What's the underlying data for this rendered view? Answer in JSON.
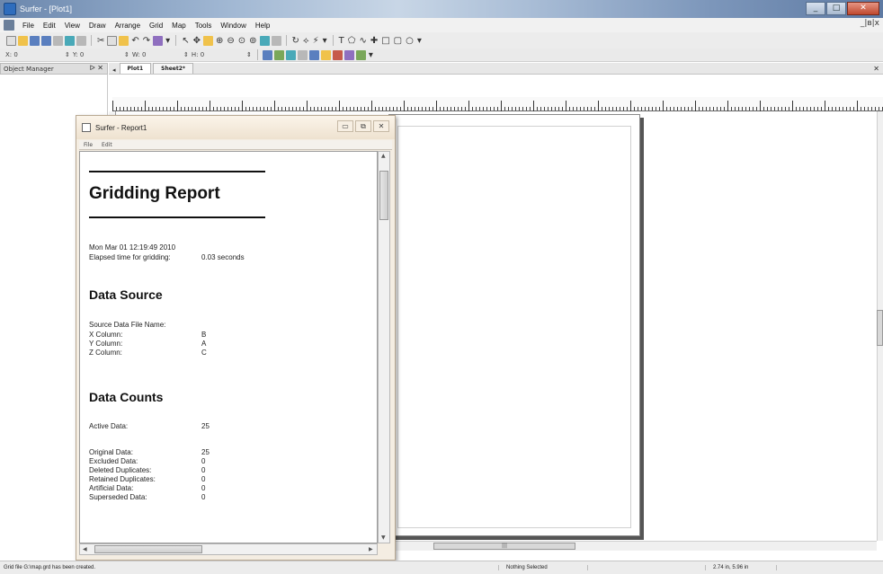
{
  "app": {
    "title": "Surfer - [Plot1]",
    "mdi_controls": "_|&#9633;|x"
  },
  "menu": [
    "File",
    "Edit",
    "View",
    "Draw",
    "Arrange",
    "Grid",
    "Map",
    "Tools",
    "Window",
    "Help"
  ],
  "toolbar2": {
    "x": "0",
    "y": "0",
    "w": "0",
    "h": "0",
    "x_label": "X:",
    "y_label": "Y:",
    "w_label": "W:",
    "h_label": "H:"
  },
  "object_manager": {
    "title": "Object Manager",
    "buttons": "ᐅ ✕"
  },
  "tabs": {
    "items": [
      "Plot1",
      "Sheet2*"
    ],
    "active": 0,
    "nav": "◂"
  },
  "report_window": {
    "title": "Surfer - Report1",
    "menu": [
      "File",
      "Edit"
    ],
    "heading": "Gridding Report",
    "date": "Mon Mar 01 12:19:49 2010",
    "elapsed_label": "Elapsed time for gridding:",
    "elapsed_value": "0.03 seconds",
    "data_source": {
      "heading": "Data Source",
      "file_label": "Source Data File Name:",
      "x_label": "X Column:",
      "x_value": "B",
      "y_label": "Y Column:",
      "y_value": "A",
      "z_label": "Z Column:",
      "z_value": "C"
    },
    "data_counts": {
      "heading": "Data Counts",
      "rows": [
        {
          "label": "Active Data:",
          "value": "25"
        },
        {
          "label": "Original Data:",
          "value": "25"
        },
        {
          "label": "Excluded Data:",
          "value": "0"
        },
        {
          "label": "Deleted Duplicates:",
          "value": "0"
        },
        {
          "label": "Retained Duplicates:",
          "value": "0"
        },
        {
          "label": "Artificial Data:",
          "value": "0"
        },
        {
          "label": "Superseded Data:",
          "value": "0"
        }
      ]
    }
  },
  "status": {
    "message": "Grid file G:\\map.grd has been created.",
    "selection": "Nothing Selected",
    "position": "2.74 in, 5.96 in"
  },
  "colors": {
    "titlebar": "#6b87ad",
    "report_frame": "#f4ede2",
    "close_button": "#c0492f"
  }
}
